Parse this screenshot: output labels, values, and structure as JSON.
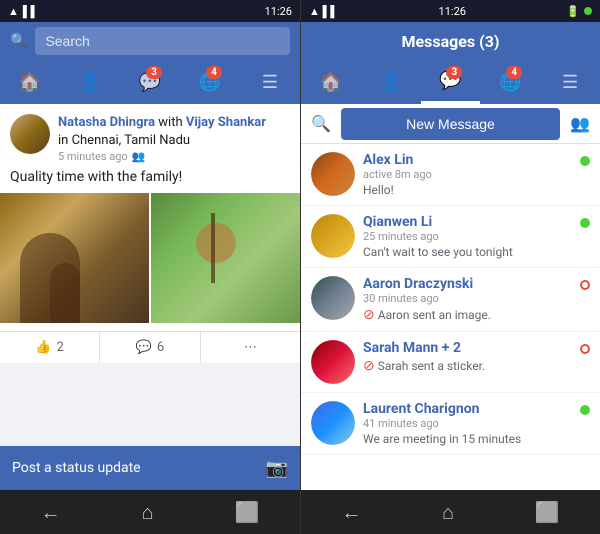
{
  "left": {
    "status_bar": {
      "time": "11:26",
      "icons": "wifi signal battery"
    },
    "search_placeholder": "Search",
    "nav": {
      "tabs": [
        {
          "id": "home",
          "icon": "🏠",
          "badge": null,
          "active": false
        },
        {
          "id": "friends",
          "icon": "👤",
          "badge": null,
          "active": false
        },
        {
          "id": "messages",
          "icon": "💬",
          "badge": "3",
          "active": false
        },
        {
          "id": "globe",
          "icon": "🌐",
          "badge": "4",
          "active": false
        },
        {
          "id": "menu",
          "icon": "☰",
          "badge": null,
          "active": false
        }
      ]
    },
    "post": {
      "author_primary": "Natasha Dhingra",
      "author_with": "with",
      "author_secondary": "Vijay Shankar",
      "location": "in Chennai, Tamil Nadu",
      "time": "5 minutes ago",
      "body": "Quality time with the family!",
      "likes": "2",
      "comments": "6"
    },
    "status_bar_update": "Post a status update",
    "bottom_nav": [
      "←",
      "⌂",
      "⬜"
    ]
  },
  "right": {
    "status_bar": {
      "time": "11:26"
    },
    "header": "Messages (3)",
    "nav": {
      "tabs": [
        {
          "id": "home",
          "icon": "🏠",
          "badge": null,
          "active": false
        },
        {
          "id": "friends",
          "icon": "👤",
          "badge": null,
          "active": false
        },
        {
          "id": "messages",
          "icon": "💬",
          "badge": "3",
          "active": true
        },
        {
          "id": "globe",
          "icon": "🌐",
          "badge": "4",
          "active": false
        },
        {
          "id": "menu",
          "icon": "☰",
          "badge": null,
          "active": false
        }
      ]
    },
    "toolbar": {
      "new_message": "New Message"
    },
    "messages": [
      {
        "id": 1,
        "name": "Alex Lin",
        "time": "active 8m ago",
        "preview": "Hello!",
        "status": "green",
        "avatar_class": "av-1"
      },
      {
        "id": 2,
        "name": "Qianwen  Li",
        "time": "25 minutes ago",
        "preview": "Can't wait to see you tonight",
        "status": "green",
        "avatar_class": "av-2"
      },
      {
        "id": 3,
        "name": "Aaron Draczynski",
        "time": "30 minutes ago",
        "preview": "Aaron sent an image.",
        "status": "red",
        "avatar_class": "av-3"
      },
      {
        "id": 4,
        "name": "Sarah Mann + 2",
        "time": "",
        "preview": "Sarah sent a sticker.",
        "status": "red",
        "avatar_class": "av-4"
      },
      {
        "id": 5,
        "name": "Laurent Charignon",
        "time": "41 minutes ago",
        "preview": "We are meeting in 15 minutes",
        "status": "green",
        "avatar_class": "av-5"
      }
    ],
    "bottom_nav": [
      "←",
      "⌂",
      "⬜"
    ]
  }
}
